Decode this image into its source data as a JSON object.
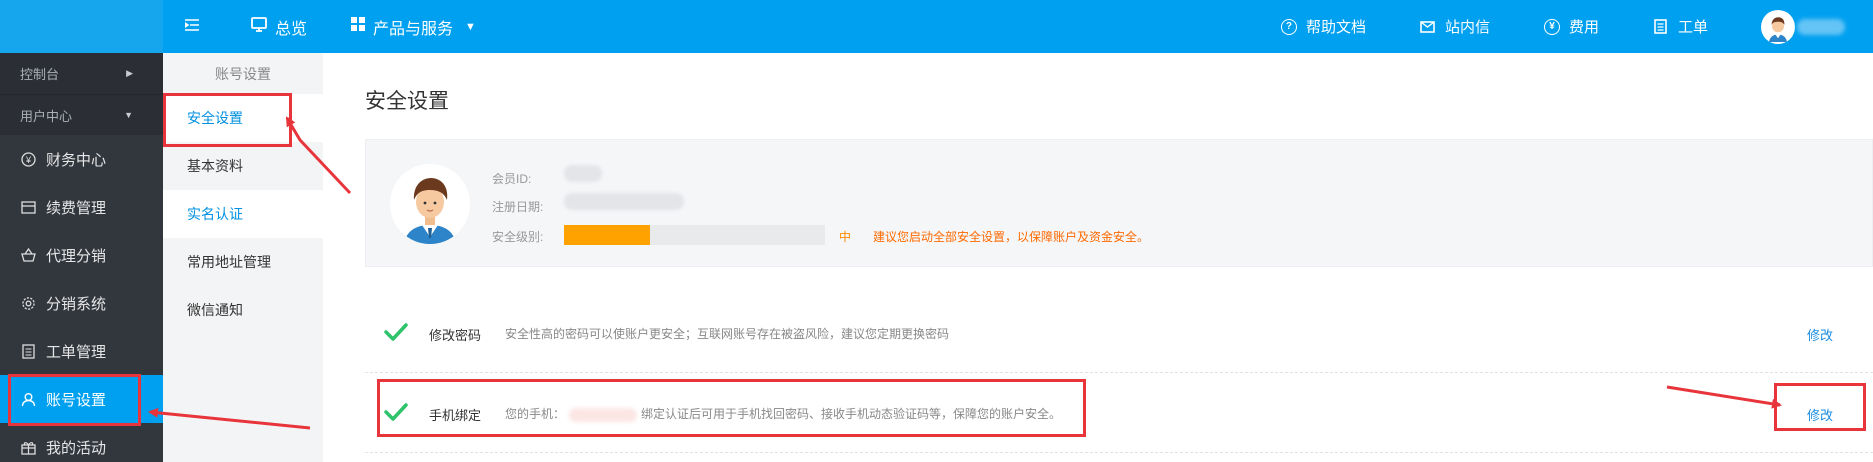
{
  "topbar": {
    "nav": [
      {
        "icon": "menu-toggle-icon",
        "label": ""
      },
      {
        "icon": "monitor-icon",
        "label": "总览"
      },
      {
        "icon": "grid-icon",
        "label": "产品与服务"
      }
    ],
    "right": [
      {
        "icon": "help-icon",
        "label": "帮助文档"
      },
      {
        "icon": "mail-icon",
        "label": "站内信"
      },
      {
        "icon": "yen-icon",
        "label": "费用"
      },
      {
        "icon": "ticket-icon",
        "label": "工单"
      }
    ]
  },
  "sidebar": {
    "sections": [
      {
        "label": "控制台",
        "arrow": "▶"
      },
      {
        "label": "用户中心",
        "arrow": "▼"
      }
    ],
    "items": [
      {
        "icon": "yen-circle-icon",
        "label": "财务中心"
      },
      {
        "icon": "card-icon",
        "label": "续费管理"
      },
      {
        "icon": "basket-icon",
        "label": "代理分销"
      },
      {
        "icon": "gear-icon",
        "label": "分销系统"
      },
      {
        "icon": "document-icon",
        "label": "工单管理"
      },
      {
        "icon": "user-icon",
        "label": "账号设置"
      },
      {
        "icon": "gift-icon",
        "label": "我的活动"
      }
    ]
  },
  "subnav": {
    "title": "账号设置",
    "items": [
      {
        "label": "安全设置"
      },
      {
        "label": "基本资料"
      },
      {
        "label": "实名认证"
      },
      {
        "label": "常用地址管理"
      },
      {
        "label": "微信通知"
      }
    ]
  },
  "main": {
    "title": "安全设置",
    "profile": {
      "member_id_label": "会员ID:",
      "reg_date_label": "注册日期:",
      "security_level_label": "安全级别:",
      "security_level_value": "中",
      "security_level_progress": 0.33,
      "security_tip": "建议您启动全部安全设置，以保障账户及资金安全。"
    },
    "rows": [
      {
        "name": "修改密码",
        "desc": "安全性高的密码可以使账户更安全；互联网账号存在被盗风险，建议您定期更换密码",
        "action": "修改"
      },
      {
        "name": "手机绑定",
        "desc_prefix": "您的手机：",
        "desc": "绑定认证后可用于手机找回密码、接收手机动态验证码等，保障您的账户安全。",
        "action": "修改"
      }
    ]
  },
  "colors": {
    "topbar": "#00a0f0",
    "sidebar": "#32373e",
    "active": "#00a0f0",
    "link": "#1a8de0",
    "warning": "#ff6a00",
    "progress": "#ffa200",
    "annotation": "#e8343b",
    "check": "#2ec26a"
  }
}
